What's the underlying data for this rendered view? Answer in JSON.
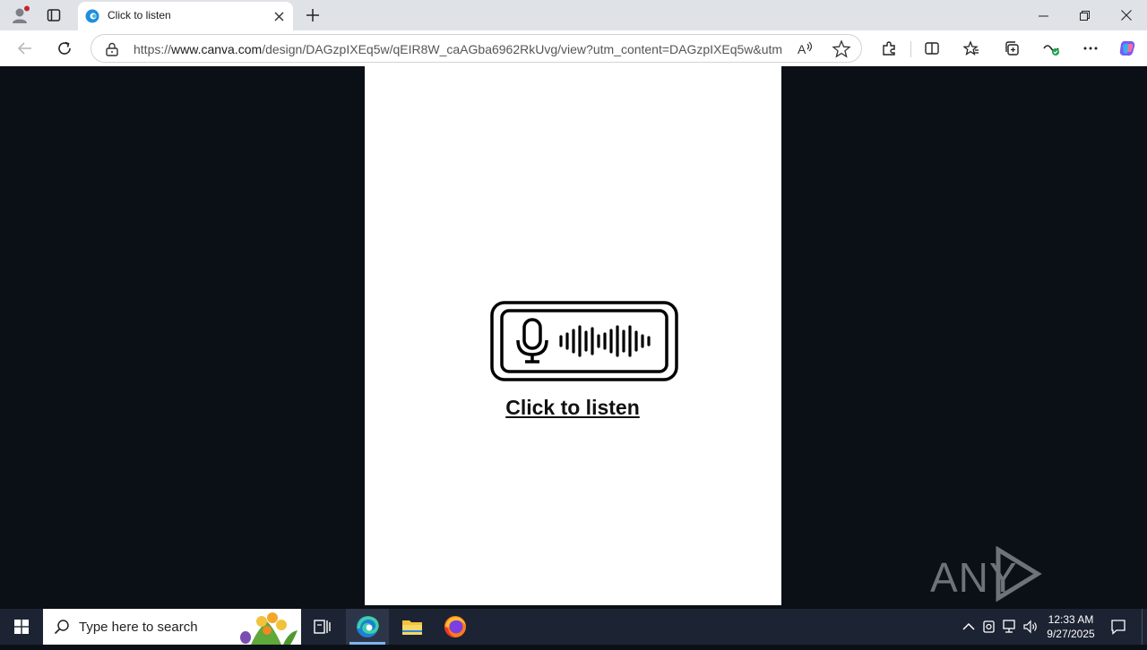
{
  "browser": {
    "tab": {
      "title": "Click to listen"
    },
    "url": {
      "prefix": "https://",
      "host": "www.canva.com",
      "path": "/design/DAGzpIXEq5w/qEIR8W_caAGba6962RkUvg/view?utm_content=DAGzpIXEq5w&utm..."
    }
  },
  "page": {
    "cta_label": "Click to listen"
  },
  "watermark": {
    "text": "ANY RUN"
  },
  "taskbar": {
    "search_placeholder": "Type here to search",
    "time": "12:33 AM",
    "date": "9/27/2025"
  },
  "colors": {
    "page_background": "#0b1016",
    "taskbar": "#1c2333",
    "tabbar": "#dfe3e8",
    "accent_edge": "#7fb4f0"
  },
  "icons": [
    "profile-icon",
    "tab-actions-icon",
    "edge-favicon",
    "close-icon",
    "plus-icon",
    "minimize-icon",
    "restore-icon",
    "back-arrow-icon",
    "reload-icon",
    "lock-icon",
    "read-aloud-icon",
    "star-icon",
    "extensions-icon",
    "split-screen-icon",
    "favorites-icon",
    "collections-icon",
    "performance-icon",
    "more-icon",
    "copilot-icon",
    "microphone-icon",
    "windows-logo-icon",
    "search-icon",
    "task-view-icon",
    "edge-icon",
    "file-explorer-icon",
    "firefox-icon",
    "chevron-up-icon",
    "network-icon",
    "volume-icon",
    "notification-icon"
  ]
}
